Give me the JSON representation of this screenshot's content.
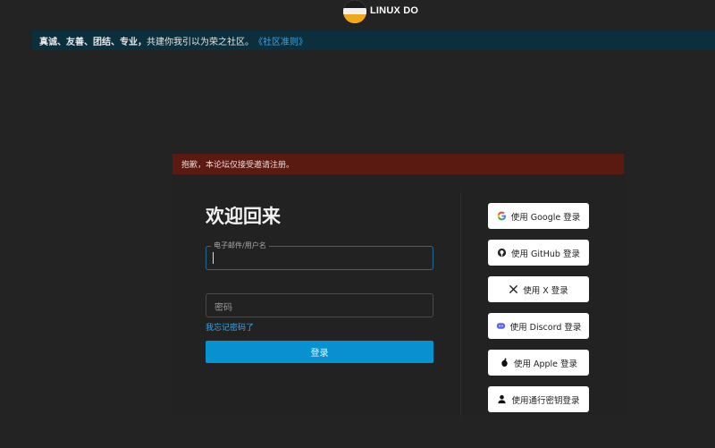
{
  "header": {
    "site_name": "LINUX DO"
  },
  "banner": {
    "values": "真诚、友善、团结、专业，",
    "message": "共建你我引以为荣之社区。",
    "link": "《社区准则》"
  },
  "alert": {
    "text": "抱歉，本论坛仅接受邀请注册。"
  },
  "login": {
    "title": "欢迎回来",
    "username_label": "电子邮件/用户名",
    "username_value": "",
    "password_placeholder": "密码",
    "forgot_link": "我忘记密码了",
    "submit_label": "登录"
  },
  "social_logins": [
    {
      "label": "使用 Google 登录",
      "icon": "google-icon"
    },
    {
      "label": "使用 GitHub 登录",
      "icon": "github-icon"
    },
    {
      "label": "使用 X 登录",
      "icon": "x-icon"
    },
    {
      "label": "使用 Discord 登录",
      "icon": "discord-icon"
    },
    {
      "label": "使用 Apple 登录",
      "icon": "apple-icon"
    },
    {
      "label": "使用通行密钥登录",
      "icon": "user-icon"
    }
  ],
  "colors": {
    "background": "#232323",
    "banner": "#0b2f3d",
    "alert": "#5a1a12",
    "primary": "#0891d0",
    "link": "#3ba6e8"
  }
}
